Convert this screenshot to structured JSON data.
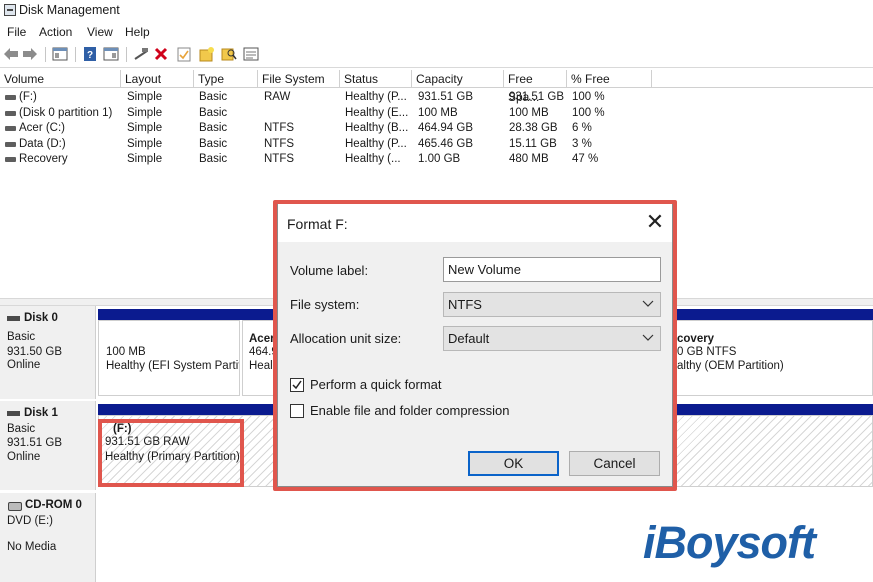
{
  "window": {
    "title": "Disk Management"
  },
  "menu": [
    "File",
    "Action",
    "View",
    "Help"
  ],
  "toolbar": {
    "icons": [
      "back-arrow-icon",
      "forward-arrow-icon",
      "properties-icon",
      "help-icon",
      "console-tree-icon",
      "connect-icon",
      "delete-icon",
      "checkmark-icon",
      "new-folder-icon",
      "search-icon",
      "list-view-icon"
    ]
  },
  "columns": [
    "Volume",
    "Layout",
    "Type",
    "File System",
    "Status",
    "Capacity",
    "Free Spa...",
    "% Free"
  ],
  "volumes": [
    {
      "volume": "(F:)",
      "layout": "Simple",
      "type": "Basic",
      "fs": "RAW",
      "status": "Healthy (P...",
      "capacity": "931.51 GB",
      "free": "931.51 GB",
      "pct": "100 %"
    },
    {
      "volume": "(Disk 0 partition 1)",
      "layout": "Simple",
      "type": "Basic",
      "fs": "",
      "status": "Healthy (E...",
      "capacity": "100 MB",
      "free": "100 MB",
      "pct": "100 %"
    },
    {
      "volume": "Acer (C:)",
      "layout": "Simple",
      "type": "Basic",
      "fs": "NTFS",
      "status": "Healthy (B...",
      "capacity": "464.94 GB",
      "free": "28.38 GB",
      "pct": "6 %"
    },
    {
      "volume": "Data (D:)",
      "layout": "Simple",
      "type": "Basic",
      "fs": "NTFS",
      "status": "Healthy (P...",
      "capacity": "465.46 GB",
      "free": "15.11 GB",
      "pct": "3 %"
    },
    {
      "volume": "Recovery",
      "layout": "Simple",
      "type": "Basic",
      "fs": "NTFS",
      "status": "Healthy (...",
      "capacity": "1.00 GB",
      "free": "480 MB",
      "pct": "47 %"
    }
  ],
  "disks": {
    "disk0": {
      "name": "Disk 0",
      "type": "Basic",
      "size": "931.50 GB",
      "state": "Online",
      "parts": [
        {
          "line1": "",
          "line2": "100 MB",
          "line3": "Healthy (EFI System Partiti"
        },
        {
          "line1": "Acer",
          "line2": "464.9",
          "line3": "Heal"
        },
        {
          "line1": "covery",
          "line2": "0 GB NTFS",
          "line3": "althy (OEM Partition)"
        }
      ]
    },
    "disk1": {
      "name": "Disk 1",
      "type": "Basic",
      "size": "931.51 GB",
      "state": "Online",
      "part": {
        "line1": "(F:)",
        "line2": "931.51 GB RAW",
        "line3": "Healthy (Primary Partition)"
      }
    },
    "cdrom0": {
      "name": "CD-ROM 0",
      "type": "DVD (E:)",
      "state": "No Media"
    }
  },
  "dialog": {
    "title": "Format F:",
    "volume_label_label": "Volume label:",
    "volume_label_value": "New Volume",
    "file_system_label": "File system:",
    "file_system_value": "NTFS",
    "alloc_label": "Allocation unit size:",
    "alloc_value": "Default",
    "quick_format_label": "Perform a quick format",
    "quick_format_checked": true,
    "compression_label": "Enable file and folder compression",
    "compression_checked": false,
    "ok_label": "OK",
    "cancel_label": "Cancel"
  },
  "watermark": "iBoysoft",
  "colors": {
    "highlight_outline": "#e0564d",
    "partition_bar": "#0b1b8f",
    "watermark": "#1f5fa7"
  }
}
